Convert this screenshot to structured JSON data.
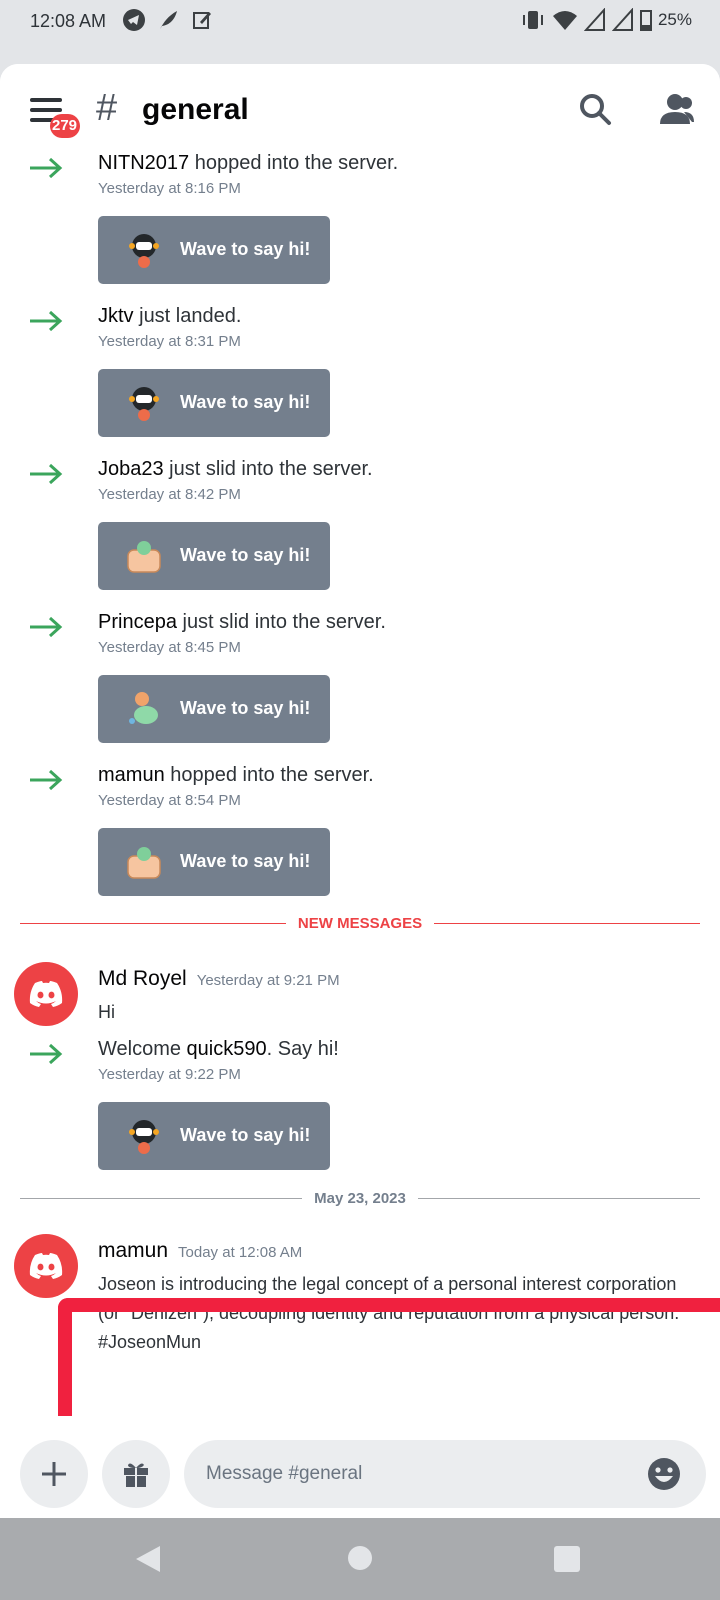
{
  "status_bar": {
    "time": "12:08 AM",
    "battery": "25%"
  },
  "header": {
    "badge": "279",
    "channel": "general"
  },
  "joins": [
    {
      "user": "NITN2017",
      "action": " hopped into the server.",
      "time": "Yesterday at 8:16 PM",
      "wave_label": "Wave to say hi!"
    },
    {
      "user": "Jktv",
      "action": " just landed.",
      "time": "Yesterday at 8:31 PM",
      "wave_label": "Wave to say hi!"
    },
    {
      "user": "Joba23",
      "action": " just slid into the server.",
      "time": "Yesterday at 8:42 PM",
      "wave_label": "Wave to say hi!"
    },
    {
      "user": "Princepa",
      "action": " just slid into the server.",
      "time": "Yesterday at 8:45 PM",
      "wave_label": "Wave to say hi!"
    },
    {
      "user": "mamun",
      "action": " hopped into the server.",
      "time": "Yesterday at 8:54 PM",
      "wave_label": "Wave to say hi!"
    }
  ],
  "new_messages_label": "NEW MESSAGES",
  "message_royel": {
    "author": "Md Royel",
    "time": "Yesterday at 9:21 PM",
    "text": "Hi"
  },
  "welcome": {
    "prefix": "Welcome ",
    "user": "quick590",
    "suffix": ". Say hi!",
    "time": "Yesterday at 9:22 PM",
    "wave_label": "Wave to say hi!"
  },
  "date_divider": "May 23, 2023",
  "message_mamun": {
    "author": "mamun",
    "time": "Today at 12:08 AM",
    "text": "Joseon is introducing the legal concept of a personal interest corporation (or “Denizen”), decoupling identity and reputation from a physical person. #JoseonMun"
  },
  "composer": {
    "placeholder": "Message #general"
  },
  "colors": {
    "accent_red": "#ed4245",
    "highlight": "#f0213f",
    "join_arrow": "#3ba55c",
    "wave_button": "#747f8d"
  }
}
